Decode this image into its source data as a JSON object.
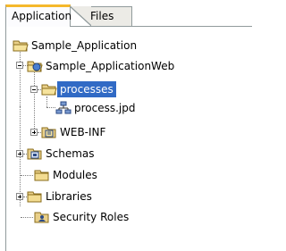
{
  "tabs": [
    {
      "label": "Application",
      "active": true
    },
    {
      "label": "Files",
      "active": false
    }
  ],
  "tree": {
    "root": "Sample_Application",
    "webapp": "Sample_ApplicationWeb",
    "processes": "processes",
    "process_file": "process.jpd",
    "webinf": "WEB-INF",
    "schemas": "Schemas",
    "modules": "Modules",
    "libraries": "Libraries",
    "security_roles": "Security Roles"
  },
  "colors": {
    "selection": "#316ac5",
    "tab_highlight": "#f5b82b",
    "folder": "#e9d08a"
  }
}
